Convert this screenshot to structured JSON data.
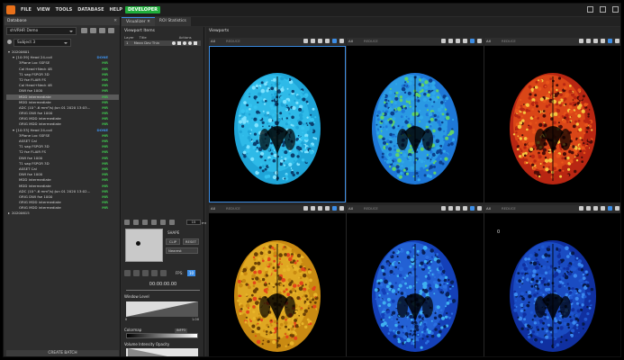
{
  "menu": [
    "FILE",
    "VIEW",
    "TOOLS",
    "DATABASE",
    "HELP",
    "DEVELOPER"
  ],
  "left_panel": {
    "title": "Database",
    "db_select": "shVRHR Demo",
    "subject_select": "Subject 3",
    "tree": [
      {
        "label": "20200601",
        "indent": 0,
        "status": "",
        "arrow": "▾"
      },
      {
        "label": "[10:39] Head 24-coil",
        "indent": 1,
        "status": "DONE",
        "blue": true,
        "arrow": "▾"
      },
      {
        "label": "3Plane Loc SSFSE",
        "indent": 2,
        "status": "MR"
      },
      {
        "label": "Cal Head+Neck 48",
        "indent": 2,
        "status": "MR"
      },
      {
        "label": "T1 sag FSPGR 3D",
        "indent": 2,
        "status": "MR"
      },
      {
        "label": "T2 fse FLAIR FS",
        "indent": 2,
        "status": "MR"
      },
      {
        "label": "Cal Head+Neck 48",
        "indent": 2,
        "status": "MR"
      },
      {
        "label": "DWI fse 1000",
        "indent": 2,
        "status": "MR"
      },
      {
        "label": "MDD intermediate",
        "indent": 2,
        "status": "MR",
        "selected": true
      },
      {
        "label": "MDD intermediate",
        "indent": 2,
        "status": "MR"
      },
      {
        "label": "ADC (10^-6 mm²/s):Jun 01 2020 13:03...",
        "indent": 2,
        "status": "MR"
      },
      {
        "label": "ORIG DWI fse 1000",
        "indent": 2,
        "status": "MR"
      },
      {
        "label": "ORIG MDD intermediate",
        "indent": 2,
        "status": "MR"
      },
      {
        "label": "ORIG MDD intermediate",
        "indent": 2,
        "status": "MR"
      },
      {
        "label": "[10:33] Head 24-coil",
        "indent": 1,
        "status": "DONE",
        "blue": true,
        "arrow": "▾"
      },
      {
        "label": "3Plane Loc SSFSE",
        "indent": 2,
        "status": "MR"
      },
      {
        "label": "ASSET Cal",
        "indent": 2,
        "status": "MR"
      },
      {
        "label": "T1 sag FSPGR 3D",
        "indent": 2,
        "status": "MR"
      },
      {
        "label": "T2 fse FLAIR FS",
        "indent": 2,
        "status": "MR"
      },
      {
        "label": "DWI fse 1000",
        "indent": 2,
        "status": "MR"
      },
      {
        "label": "T1 sag FSPGR 3D",
        "indent": 2,
        "status": "MR"
      },
      {
        "label": "ASSET Cal",
        "indent": 2,
        "status": "MR"
      },
      {
        "label": "DWI fse 1000",
        "indent": 2,
        "status": "MR"
      },
      {
        "label": "MDD intermediate",
        "indent": 2,
        "status": "MR"
      },
      {
        "label": "MDD intermediate",
        "indent": 2,
        "status": "MR"
      },
      {
        "label": "ADC (10^-6 mm²/s):Jun 01 2020 13:02...",
        "indent": 2,
        "status": "MR"
      },
      {
        "label": "ORIG DWI fse 1000",
        "indent": 2,
        "status": "MR"
      },
      {
        "label": "ORIG MDD intermediate",
        "indent": 2,
        "status": "MR"
      },
      {
        "label": "ORIG MDD intermediate",
        "indent": 2,
        "status": "MR"
      },
      {
        "label": "20200615",
        "indent": 0,
        "status": "",
        "arrow": "▸"
      }
    ],
    "create_batch": "CREATE BATCH"
  },
  "tabs": [
    "Visualizer",
    "ROI Statistics"
  ],
  "viewport_items": {
    "title": "Viewport Items",
    "col_layer": "Layer",
    "col_title": "Title",
    "col_actions": "Actions",
    "item_index": "1",
    "item_title": "Mean Dev Thin",
    "spin_value": "15",
    "spin_unit": "mm",
    "shape_label": "SHAPE",
    "btn_clip": "CLIP",
    "btn_reset": "RESET",
    "shape_select": "Nearest",
    "fps_label": "FPS:",
    "fps_value": "10",
    "time": "00:00:00.00",
    "window_level_label": "Window Level",
    "wl_min": "0",
    "wl_max": "1.00",
    "colormap_label": "Colormap",
    "colormap_name": "INFP3",
    "volume_opacity_label": "Volume Intensity Opacity"
  },
  "viewports": {
    "title": "Viewports",
    "ax_label": "AX",
    "reduce_label": "REDUCE",
    "cells": [
      {
        "name": "viewport-1",
        "scheme": "cyan",
        "active": true
      },
      {
        "name": "viewport-2",
        "scheme": "blue-green"
      },
      {
        "name": "viewport-3",
        "scheme": "red-yellow"
      },
      {
        "name": "viewport-4",
        "scheme": "yellow-red"
      },
      {
        "name": "viewport-5",
        "scheme": "blue-cyan"
      },
      {
        "name": "viewport-6",
        "scheme": "blue-deep",
        "label": "0"
      }
    ]
  },
  "colors": {
    "accent": "#3d8ee6",
    "done": "#3ec24d",
    "dev": "#1fae3b"
  }
}
